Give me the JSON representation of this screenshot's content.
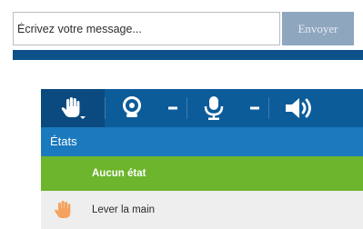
{
  "message": {
    "placeholder": "Écrivez votre message...",
    "value": "",
    "send_label": "Envoyer"
  },
  "toolbar": {
    "buttons": [
      {
        "name": "raise-hand",
        "icon": "hand-icon"
      },
      {
        "name": "webcam",
        "icon": "webcam-icon"
      },
      {
        "name": "webcam-options",
        "icon": "chevron-down-icon"
      },
      {
        "name": "microphone",
        "icon": "microphone-icon"
      },
      {
        "name": "microphone-options",
        "icon": "chevron-down-icon"
      },
      {
        "name": "speaker",
        "icon": "speaker-icon"
      }
    ]
  },
  "states": {
    "title": "États",
    "items": [
      {
        "label": "Aucun état",
        "selected": true
      },
      {
        "label": "Lever la main",
        "icon": "hand-icon",
        "selected": false
      }
    ]
  },
  "colors": {
    "send_button": "#8fa6bf",
    "divider_bar": "#0c5188",
    "toolbar": "#0d5c9a",
    "states_header": "#1b79bd",
    "selected_state": "#6cb52c",
    "hand_orange": "#f5a25e"
  }
}
